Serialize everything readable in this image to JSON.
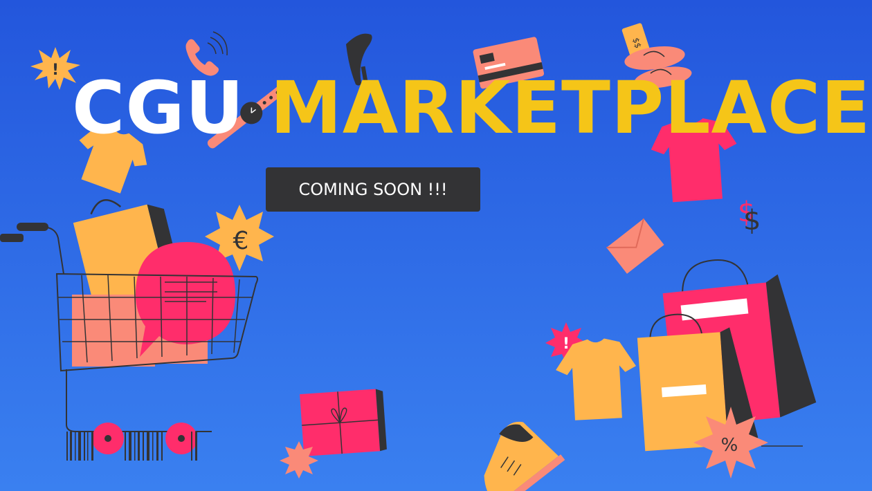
{
  "hero": {
    "title_white": "CGU",
    "title_yellow": "MARKETPLACE",
    "cta_label": "COMING SOON !!!"
  },
  "badges": {
    "exclaim_1": "!",
    "exclaim_2": "!",
    "euro": "€",
    "percent": "%",
    "dollar": "$",
    "tag_dollar": "$$"
  },
  "colors": {
    "bg_top": "#2356dc",
    "bg_bottom": "#3a80f0",
    "title_yellow": "#f5c518",
    "pink": "#ff2d6b",
    "orange": "#ffb54d",
    "salmon": "#fa8a78",
    "dark": "#333335"
  },
  "icons": [
    "phone-icon",
    "high-heel-icon",
    "credit-card-icon",
    "price-tag-icon",
    "flip-flops-icon",
    "watch-icon",
    "tshirt-icon",
    "shopping-cart-icon",
    "shopping-bag-icon",
    "envelope-icon",
    "gift-box-icon",
    "shoe-icon",
    "barcode-icon"
  ]
}
